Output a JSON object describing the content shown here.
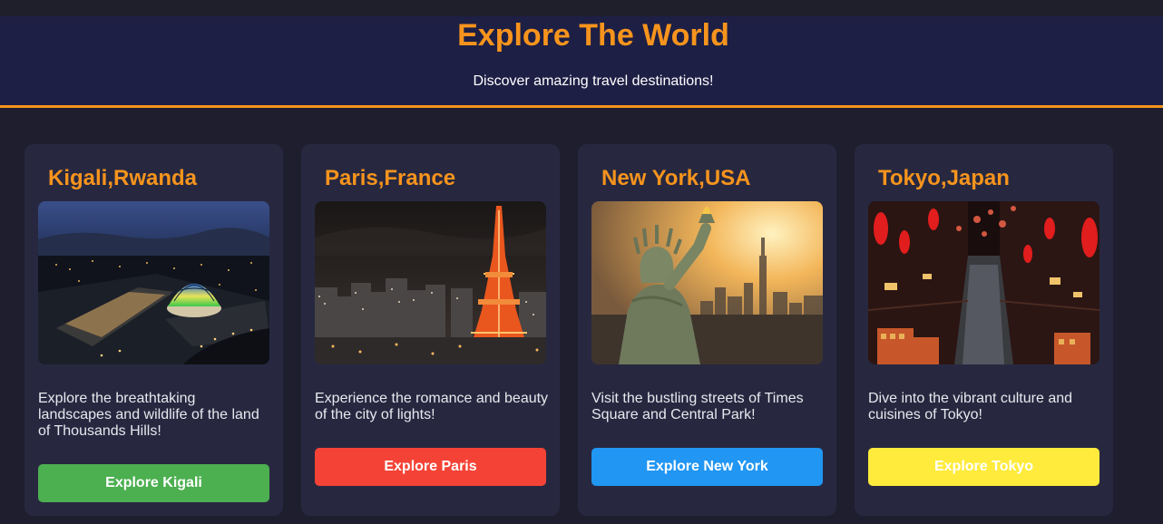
{
  "header": {
    "title": "Explore The World",
    "subtitle": "Discover amazing travel destinations!"
  },
  "colors": {
    "accent": "#f7941d",
    "page_background": "#1e1e2e",
    "header_background": "#1d1f45",
    "card_background": "#272840"
  },
  "cards": [
    {
      "title": "Kigali,Rwanda",
      "image": "kigali-convention-centre-night-photo",
      "description": "Explore the breathtaking landscapes and wildlife of the land of Thousands Hills!",
      "button_label": "Explore Kigali",
      "button_color": "#4caf50"
    },
    {
      "title": "Paris,France",
      "image": "tokyo-tower-night-cityscape-photo",
      "description": "Experience the romance and beauty of the city of lights!",
      "button_label": "Explore Paris",
      "button_color": "#f44336"
    },
    {
      "title": "New York,USA",
      "image": "statue-of-liberty-manhattan-sunset-photo",
      "description": "Visit the bustling streets of Times Square and Central Park!",
      "button_label": "Explore New York",
      "button_color": "#2196f3"
    },
    {
      "title": "Tokyo,Japan",
      "image": "tokyo-alley-red-lanterns-photo",
      "description": "Dive into the vibrant culture and cuisines of Tokyo!",
      "button_label": "Explore Tokyo",
      "button_color": "#ffeb3b"
    }
  ]
}
